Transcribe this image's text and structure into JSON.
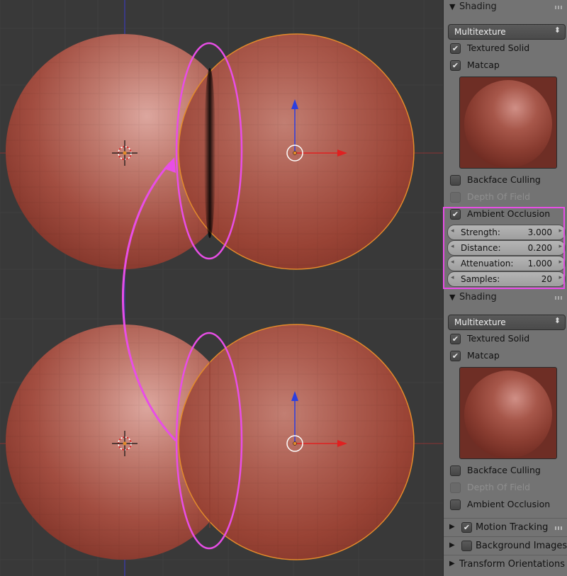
{
  "panel": {
    "top_section": {
      "title": "Shading",
      "dropdown_value": "Multitexture",
      "textured_solid_label": "Textured Solid",
      "matcap_label": "Matcap",
      "backface_culling_label": "Backface Culling",
      "depth_of_field_label": "Depth Of Field",
      "ambient_occlusion_label": "Ambient Occlusion",
      "textured_solid_checked": true,
      "matcap_checked": true,
      "backface_culling_checked": false,
      "ambient_occlusion_checked": true
    },
    "ao_settings": [
      {
        "label": "Strength:",
        "value": "3.000"
      },
      {
        "label": "Distance:",
        "value": "0.200"
      },
      {
        "label": "Attenuation:",
        "value": "1.000"
      },
      {
        "label": "Samples:",
        "value": "20"
      }
    ],
    "bottom_section": {
      "title": "Shading",
      "dropdown_value": "Multitexture",
      "textured_solid_label": "Textured Solid",
      "matcap_label": "Matcap",
      "backface_culling_label": "Backface Culling",
      "depth_of_field_label": "Depth Of Field",
      "ambient_occlusion_label": "Ambient Occlusion",
      "textured_solid_checked": true,
      "matcap_checked": true,
      "backface_culling_checked": false,
      "ambient_occlusion_checked": false
    },
    "collapsed_panels": {
      "motion_tracking": "Motion Tracking",
      "background_images": "Background Images",
      "transform_orientations": "Transform Orientations"
    },
    "icons": {
      "expanded": "▼",
      "collapsed": "▶",
      "check": "✔",
      "dropdown_arrows": "⬍",
      "left_arrow": "◂",
      "right_arrow": "▸"
    }
  },
  "colors": {
    "annotation": "#e84ee6",
    "sphere": "#a3493c",
    "selection_outline": "#e38b2b",
    "axis_x": "#e02020",
    "axis_z": "#2b3fe0"
  }
}
